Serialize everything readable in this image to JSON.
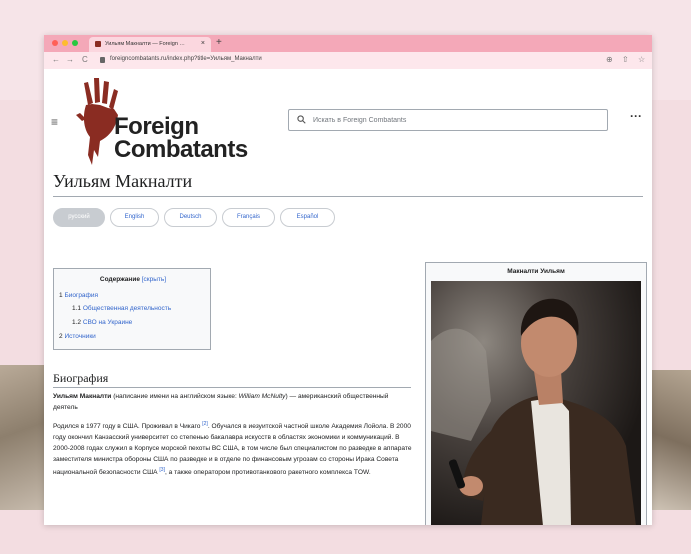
{
  "browser": {
    "tab_title": "Уильям Макналти — Foreign …",
    "tab_close": "×",
    "new_tab": "+",
    "url": "foreigncombatants.ru/index.php?title=Уильям_Макналти",
    "nav_back": "←",
    "nav_forward": "→",
    "nav_reload": "C",
    "tool_icons": [
      "⊕",
      "⇧",
      "☆"
    ]
  },
  "header": {
    "menu_glyph": "≡",
    "logo_line1": "Foreign",
    "logo_line2": "Combatants",
    "search_placeholder": "Искать в Foreign Combatants",
    "more_glyph": "···"
  },
  "page": {
    "title": "Уильям Макналти",
    "languages": [
      {
        "label": "русский",
        "selected": true
      },
      {
        "label": "English",
        "selected": false
      },
      {
        "label": "Deutsch",
        "selected": false
      },
      {
        "label": "Français",
        "selected": false
      },
      {
        "label": "Español",
        "selected": false
      }
    ]
  },
  "toc": {
    "title": "Содержание",
    "hide": "[скрыть]",
    "items": [
      {
        "num": "1",
        "label": "Биография"
      },
      {
        "num": "1.1",
        "label": "Общественная деятельность"
      },
      {
        "num": "1.2",
        "label": "СВО на Украине"
      },
      {
        "num": "2",
        "label": "Источники"
      }
    ]
  },
  "infobox": {
    "caption": "Макналти Уильям"
  },
  "article": {
    "section_title": "Биография",
    "p1_bold": "Уильям Макналти",
    "p1_a": " (написание имени на английском языке: ",
    "p1_italic": "William McNulty",
    "p1_b": ") — американский общественный деятель",
    "p2_a": "Родился в 1977 году в США. Проживал в Чикаго ",
    "ref2": "[2]",
    "p2_b": ". Обучался в иезуитской частной школе Академия Лойола. В 2000 году окончил Канзасский университет со степенью бакалавра искусств в областях экономики и коммуникаций. В 2000-2008 годах служил в Корпусе морской пехоты ВС США, в том числе был специалистом по разведке в аппарате заместителя министра обороны США по разведке и в отделе по финансовым угрозам со стороны Ирака Совета национальной безопасности США ",
    "ref3": "[3]",
    "p2_c": ", а также оператором противотанкового ракетного комплекса TOW."
  },
  "colors": {
    "titlebar": "#f4a8b8",
    "link": "#3366cc",
    "logo_red": "#8a2c22",
    "backdrop": "#f3dde1"
  }
}
